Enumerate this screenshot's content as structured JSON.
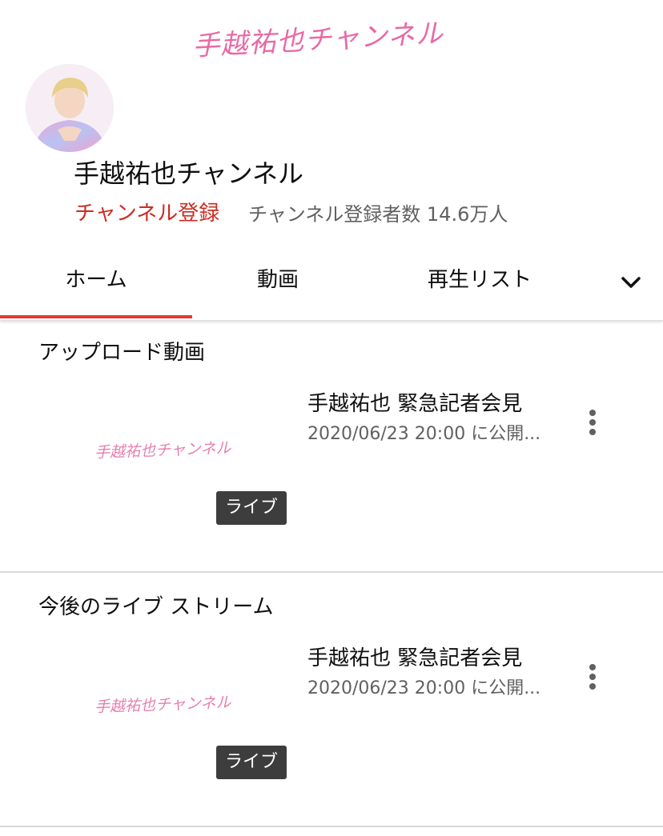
{
  "banner": {
    "logo_text": "手越祐也チャンネル"
  },
  "channel": {
    "name": "手越祐也チャンネル",
    "subscribe_label": "チャンネル登録",
    "subscriber_count": "チャンネル登録者数 14.6万人"
  },
  "tabs": [
    {
      "label": "ホーム",
      "selected": true
    },
    {
      "label": "動画",
      "selected": false
    },
    {
      "label": "再生リスト",
      "selected": false
    }
  ],
  "sections": [
    {
      "title": "アップロード動画",
      "video": {
        "thumbnail_logo": "手越祐也チャンネル",
        "badge": "ライブ",
        "title": "手越祐也 緊急記者会見",
        "meta": "2020/06/23 20:00 に公開..."
      }
    },
    {
      "title": "今後のライブ ストリーム",
      "video": {
        "thumbnail_logo": "手越祐也チャンネル",
        "badge": "ライブ",
        "title": "手越祐也 緊急記者会見",
        "meta": "2020/06/23 20:00 に公開..."
      }
    }
  ],
  "icons": {
    "tabs_more": "chevron-down-icon",
    "video_menu": "more-vert-icon"
  },
  "colors": {
    "subscribe": "#cc2c20",
    "tab_indicator": "#e53935",
    "logo_pink": "#e86aa6",
    "badge_bg": "#3d3d3d"
  }
}
